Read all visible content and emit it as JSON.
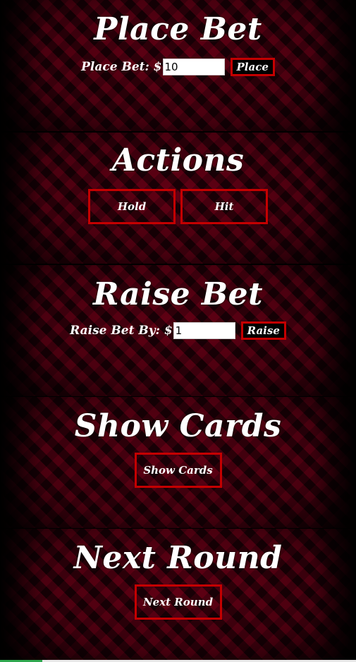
{
  "place_bet": {
    "title": "Place Bet",
    "label": "Place Bet: $",
    "input_value": "10",
    "button": "Place"
  },
  "actions": {
    "title": "Actions",
    "hold_button": "Hold",
    "hit_button": "Hit"
  },
  "raise_bet": {
    "title": "Raise Bet",
    "label": "Raise Bet By: $",
    "input_value": "1",
    "button": "Raise"
  },
  "show_cards": {
    "title": "Show Cards",
    "button": "Show Cards"
  },
  "next_round": {
    "title": "Next Round",
    "button": "Next Round"
  },
  "colors": {
    "button_border": "#c40000",
    "background": "#000000",
    "pattern": "#7a0019"
  }
}
